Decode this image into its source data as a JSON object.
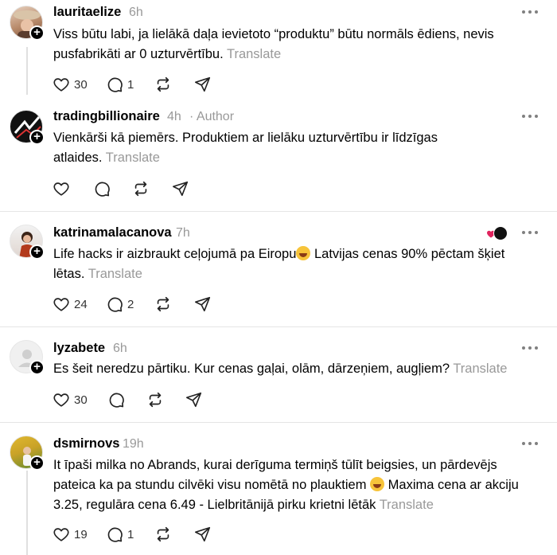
{
  "posts": [
    {
      "username": "lauritaelize",
      "time": "6h",
      "author_tag": "",
      "text": "Viss būtu labi, ja lielākā daļa ievietoto “produktu” būtu normāls ēdiens, nevis pusfabrikāti ar 0 uzturvērtību.",
      "translate": "Translate",
      "likes": "30",
      "replies": "1",
      "reposts": "",
      "avatar_color": "#b88a6a"
    },
    {
      "username": "tradingbillionaire",
      "time": "4h",
      "author_tag": "· Author",
      "text": "Vienkārši kā piemērs. Produktiem ar lielāku uzturvērtību ir līdzīgas atlaides.",
      "translate": "Translate",
      "likes": "",
      "replies": "",
      "reposts": "",
      "avatar_color": "#111111"
    },
    {
      "username": "katrinamalacanova",
      "time": "7h",
      "author_tag": "",
      "text_before_emoji": "Life hacks ir aizbraukt ceļojumā pa Eiropu",
      "text_after_emoji": " Latvijas cenas 90% pēctam šķiet lētas.",
      "translate": "Translate",
      "likes": "24",
      "replies": "2",
      "reposts": "",
      "avatar_color": "#a0522d"
    },
    {
      "username": "lyzabete",
      "time": "6h",
      "author_tag": "",
      "text": "Es šeit neredzu pārtiku. Kur cenas gaļai, olām, dārzeņiem, augļiem?",
      "translate": "Translate",
      "likes": "30",
      "replies": "",
      "reposts": "",
      "avatar_color": "#e8e8e8"
    },
    {
      "username": "dsmirnovs",
      "time": "19h",
      "author_tag": "",
      "text_before_emoji": "It īpaši milka no Abrands, kurai derīguma termiņš tūlīt beigsies, un pārdevējs pateica ka pa stundu cilvēki visu nomētā no plauktiem",
      "text_after_emoji": " Maxima cena ar akciju 3.25, regulāra cena 6.49 - Lielbritānijā pirku krietni lētāk",
      "translate": "Translate",
      "likes": "19",
      "replies": "1",
      "reposts": "",
      "avatar_color": "#c9a227"
    }
  ],
  "icons": {
    "like": "heart-icon",
    "reply": "comment-icon",
    "repost": "repost-icon",
    "share": "send-icon",
    "more": "more-icon",
    "follow": "plus-icon"
  },
  "colors": {
    "text": "#000000",
    "muted": "#999999",
    "divider": "#e5e5e5",
    "liked_heart": "#e0245e"
  }
}
